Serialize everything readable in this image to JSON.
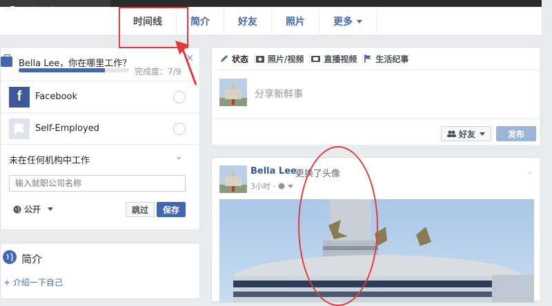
{
  "cover": {
    "update_photo_label": "更换头像"
  },
  "nav": {
    "tabs": [
      {
        "label": "时间线"
      },
      {
        "label": "简介"
      },
      {
        "label": "好友"
      },
      {
        "label": "照片"
      },
      {
        "label": "更多"
      }
    ]
  },
  "work": {
    "question": "Bella Lee，你在哪里工作？",
    "progress": 0.78,
    "progress_label": "完成度：7/9",
    "options": [
      {
        "name": "Facebook"
      },
      {
        "name": "Self-Employed"
      }
    ],
    "none_label": "未在任何机构中工作",
    "input_placeholder": "输入就职公司名称",
    "privacy_label": "公开",
    "skip_label": "跳过",
    "save_label": "保存"
  },
  "intro": {
    "title": "简介",
    "add_label": "介绍一下自己"
  },
  "composer": {
    "tabs": [
      {
        "label": "状态",
        "icon": "pencil-icon"
      },
      {
        "label": "照片/视频",
        "icon": "camera-icon"
      },
      {
        "label": "直播视频",
        "icon": "video-icon"
      },
      {
        "label": "生活纪事",
        "icon": "flag-icon"
      }
    ],
    "placeholder": "分享新鲜事",
    "audience_label": "好友",
    "post_label": "发布"
  },
  "post": {
    "author": "Bella Lee",
    "action": "更换了头像",
    "time": "3小时 ·"
  },
  "colors": {
    "accent": "#4267b2",
    "annotation": "#e23a3a"
  }
}
